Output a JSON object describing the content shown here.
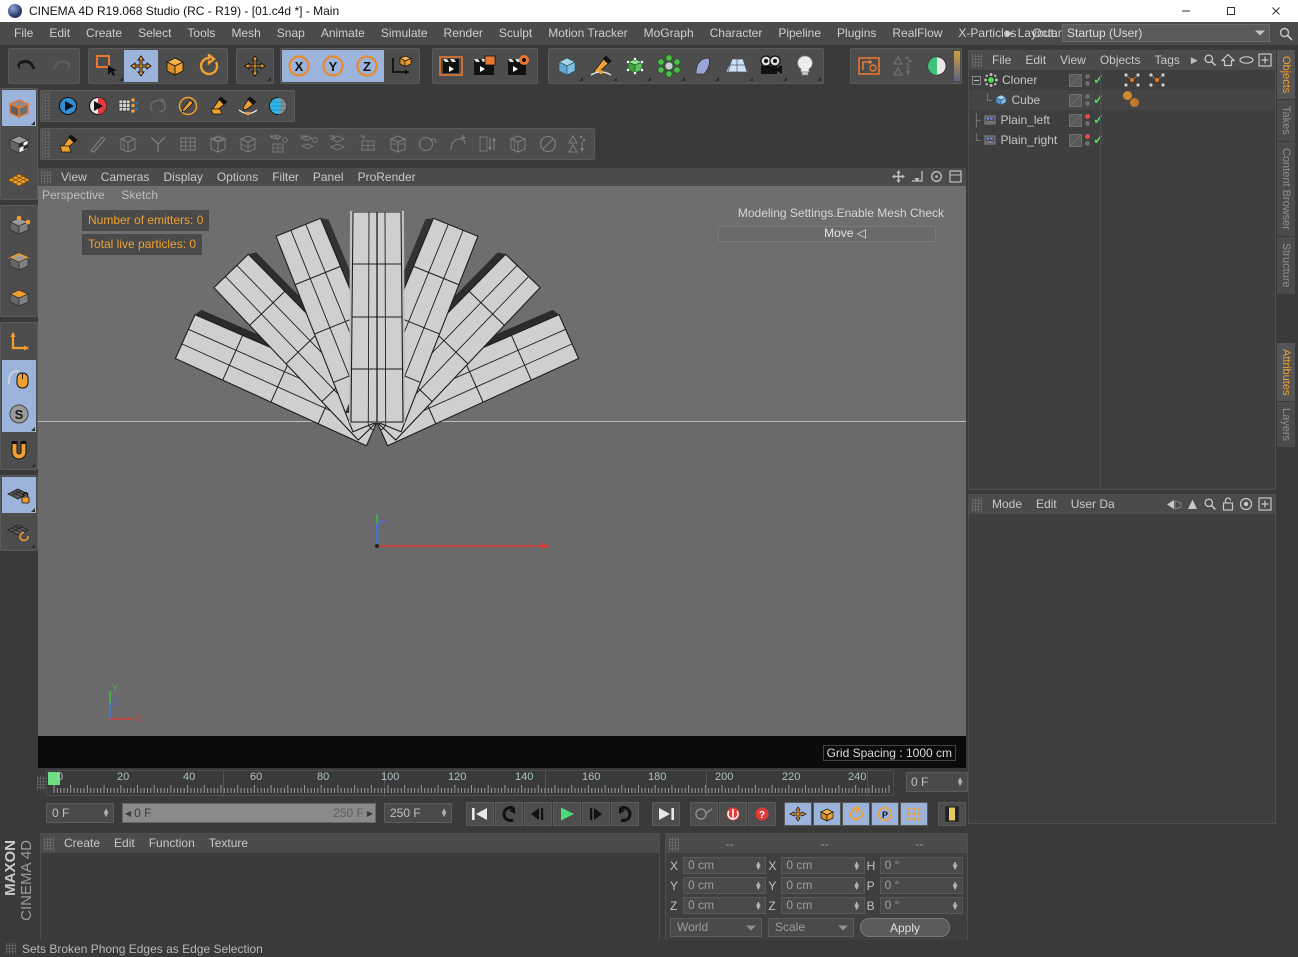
{
  "window": {
    "title": "CINEMA 4D R19.068 Studio (RC - R19) - [01.c4d *] - Main",
    "app_icon": "c4d-logo-icon",
    "minimize": "—",
    "maximize": "☐",
    "close": "✕"
  },
  "menubar": {
    "items": [
      "File",
      "Edit",
      "Create",
      "Select",
      "Tools",
      "Mesh",
      "Snap",
      "Animate",
      "Simulate",
      "Render",
      "Sculpt",
      "Motion Tracker",
      "MoGraph",
      "Character",
      "Pipeline",
      "Plugins",
      "RealFlow",
      "X-Particles",
      "Octane"
    ],
    "layout_label": "Layout:",
    "layout_value": "Startup (User)",
    "search_icon": "magnifier-icon"
  },
  "toolbar": {
    "row1": [
      {
        "name": "undo-button",
        "icon": "undo-arrow-icon",
        "active": false
      },
      {
        "name": "redo-button",
        "icon": "redo-arrow-icon",
        "active": false
      },
      {
        "name": "live-selection-button",
        "icon": "selection-square-icon",
        "active": false
      },
      {
        "name": "move-tool-button",
        "icon": "move-cross-icon",
        "active": true
      },
      {
        "name": "scale-tool-button",
        "icon": "scale-box-icon",
        "active": false
      },
      {
        "name": "rotate-tool-button",
        "icon": "rotate-circle-icon",
        "active": false
      },
      {
        "name": "move-axis-button",
        "icon": "move-cross-icon",
        "active": false
      },
      {
        "name": "lock-x-axis-button",
        "icon": "axis-x-icon",
        "active": true
      },
      {
        "name": "lock-y-axis-button",
        "icon": "axis-y-icon",
        "active": true
      },
      {
        "name": "lock-z-axis-button",
        "icon": "axis-z-icon",
        "active": true
      },
      {
        "name": "world-object-coordinates-button",
        "icon": "world-axis-icon",
        "active": false
      },
      {
        "name": "render-view-button",
        "icon": "render-clapper-icon",
        "active": false
      },
      {
        "name": "render-region-button",
        "icon": "render-region-icon",
        "active": false
      },
      {
        "name": "render-settings-button",
        "icon": "render-gear-icon",
        "active": false
      },
      {
        "name": "add-cube-button",
        "icon": "cube-primitive-icon",
        "active": false
      },
      {
        "name": "add-spline-button",
        "icon": "pen-spline-icon",
        "active": false
      },
      {
        "name": "add-generator-button",
        "icon": "green-cube-icon",
        "active": false
      },
      {
        "name": "add-deformer-button",
        "icon": "deformer-icon",
        "active": false
      },
      {
        "name": "add-scene-button",
        "icon": "bend-object-icon",
        "active": false
      },
      {
        "name": "add-floor-button",
        "icon": "floor-grid-icon",
        "active": false
      },
      {
        "name": "add-camera-button",
        "icon": "camera-icon",
        "active": false
      },
      {
        "name": "add-light-button",
        "icon": "lightbulb-icon",
        "active": false
      },
      {
        "name": "make-editable-button",
        "icon": "make-editable-icon",
        "active": false
      },
      {
        "name": "sort-button",
        "icon": "sort-icon",
        "active": false
      },
      {
        "name": "viewport-shading-button",
        "icon": "half-sphere-icon",
        "active": false
      }
    ],
    "row2": [
      {
        "name": "simulate-play-button",
        "icon": "blue-play-icon",
        "active": false
      },
      {
        "name": "record-button",
        "icon": "red-play-icon",
        "active": false
      },
      {
        "name": "point-mode-grid-button",
        "icon": "points-grid-icon",
        "active": false
      },
      {
        "name": "spline-select-button",
        "icon": "spline-lasso-icon",
        "active": false
      },
      {
        "name": "knife-button",
        "icon": "pen-circle-icon",
        "active": false
      },
      {
        "name": "polygon-pen-button",
        "icon": "polygon-pen-icon",
        "active": false
      },
      {
        "name": "spline-pen-button",
        "icon": "spline-pen-icon",
        "active": false
      },
      {
        "name": "sculpt-brush-button",
        "icon": "blue-sphere-icon",
        "active": false
      }
    ],
    "row3_count": 20
  },
  "left_palette": {
    "groups": [
      [
        {
          "name": "model-mode-button",
          "icon": "model-cube-icon",
          "active": true
        },
        {
          "name": "texture-mode-button",
          "icon": "checker-cube-icon",
          "active": false
        },
        {
          "name": "workplane-mode-button",
          "icon": "orange-grid-icon",
          "active": false
        }
      ],
      [
        {
          "name": "point-mode-button",
          "icon": "point-cube-icon",
          "active": false
        },
        {
          "name": "edge-mode-button",
          "icon": "edge-cube-icon",
          "active": false
        },
        {
          "name": "polygon-mode-button",
          "icon": "polygon-cube-icon",
          "active": false
        }
      ],
      [
        {
          "name": "object-axis-mode-button",
          "icon": "axis-l-icon",
          "active": false
        },
        {
          "name": "viewport-solo-button",
          "icon": "mouse-icon",
          "active": true
        },
        {
          "name": "enable-snapping-button",
          "icon": "s-snap-icon",
          "active": true
        },
        {
          "name": "magnet-button",
          "icon": "magnet-icon",
          "active": false
        }
      ],
      [
        {
          "name": "workplane-lock-button",
          "icon": "grid-lock-icon",
          "active": true
        },
        {
          "name": "planar-workplane-button",
          "icon": "grid-rotate-icon",
          "active": false
        }
      ]
    ]
  },
  "viewport": {
    "menu_items": [
      "View",
      "Cameras",
      "Display",
      "Options",
      "Filter",
      "Panel",
      "ProRender"
    ],
    "perspective_label": "Perspective",
    "sketch_label": "Sketch",
    "hud_emitters": "Number of emitters: 0",
    "hud_particles": "Total live particles: 0",
    "mesh_check_text": "Modeling Settings.Enable Mesh Check",
    "move_text": "Move ◁",
    "grid_spacing": "Grid Spacing : 1000 cm",
    "axis_labels": {
      "x": "X",
      "y": "Y",
      "z": "Z"
    },
    "panel_icons": [
      "move-viewport-icon",
      "scale-viewport-icon",
      "rotate-viewport-icon",
      "maximize-viewport-icon"
    ]
  },
  "object_manager": {
    "menu_items": [
      "File",
      "Edit",
      "View",
      "Objects",
      "Tags"
    ],
    "overflow_icon": "chevron-right-icon",
    "icons": [
      "magnifier-icon",
      "home-icon",
      "eye-icon",
      "expand-icon"
    ],
    "rows": [
      {
        "name": "Cloner",
        "icon": "cloner-icon",
        "indent": 0,
        "expander": "minus",
        "dot_top": "gray",
        "dot_bottom": "gray",
        "check": true,
        "tags": [
          "mograph-tag",
          "mograph-tag"
        ]
      },
      {
        "name": "Cube",
        "icon": "cube-icon",
        "indent": 1,
        "expander": "none",
        "dot_top": "gray",
        "dot_bottom": "gray",
        "check": true,
        "tags": [
          "orange-dot-tag",
          "orange-dot-tag"
        ]
      },
      {
        "name": "Plain_left",
        "icon": "effector-icon",
        "indent": 0,
        "expander": "none",
        "dot_top": "red",
        "dot_bottom": "gray",
        "check": true,
        "tags": []
      },
      {
        "name": "Plain_right",
        "icon": "effector-icon",
        "indent": 0,
        "expander": "none",
        "dot_top": "red",
        "dot_bottom": "gray",
        "check": true,
        "tags": []
      }
    ]
  },
  "attribute_manager": {
    "menu_items": [
      "Mode",
      "Edit",
      "User Da"
    ],
    "icons": [
      "back-nav-icon",
      "forward-nav-icon",
      "up-arrow-icon",
      "magnifier-icon",
      "lock-icon",
      "target-icon",
      "expand-icon"
    ]
  },
  "right_tabs": {
    "top": [
      {
        "label": "Objects",
        "active": true
      },
      {
        "label": "Takes",
        "active": false
      },
      {
        "label": "Content Browser",
        "active": false
      },
      {
        "label": "Structure",
        "active": false
      }
    ],
    "bottom": [
      {
        "label": "Attributes",
        "active": true
      },
      {
        "label": "Layers",
        "active": false
      }
    ]
  },
  "timeline": {
    "labels": [
      "0",
      "20",
      "40",
      "60",
      "80",
      "100",
      "120",
      "140",
      "160",
      "180",
      "200",
      "220",
      "240"
    ],
    "current_frame_field": "0 F",
    "start_field": "0 F",
    "slider_left": "0 F",
    "slider_right": "250 F",
    "end_field": "250 F",
    "range_end": "250 F"
  },
  "transport": {
    "buttons": [
      {
        "name": "goto-start-button",
        "icon": "skip-start-icon"
      },
      {
        "name": "previous-keyframe-button",
        "icon": "prev-key-icon"
      },
      {
        "name": "previous-frame-button",
        "icon": "step-back-icon"
      },
      {
        "name": "play-button",
        "icon": "play-icon"
      },
      {
        "name": "next-frame-button",
        "icon": "step-forward-icon"
      },
      {
        "name": "next-keyframe-button",
        "icon": "next-key-icon"
      },
      {
        "name": "goto-end-button",
        "icon": "skip-end-icon"
      }
    ],
    "record_buttons": [
      {
        "name": "record-active-objects-button",
        "icon": "key-icon",
        "active": false
      },
      {
        "name": "autokeying-button",
        "icon": "red-record-icon",
        "active": false
      },
      {
        "name": "keyframe-selection-button",
        "icon": "question-record-icon",
        "active": false
      }
    ],
    "toggle_buttons": [
      {
        "name": "position-key-button",
        "icon": "move-cross-icon",
        "active": true
      },
      {
        "name": "scale-key-button",
        "icon": "scale-box-icon",
        "active": true
      },
      {
        "name": "rotation-key-button",
        "icon": "rotate-circle-icon",
        "active": true
      },
      {
        "name": "parameter-key-button",
        "icon": "p-circle-icon",
        "active": true
      },
      {
        "name": "point-level-animation-button",
        "icon": "pla-dots-icon",
        "active": true
      }
    ],
    "timeline_button": {
      "name": "open-timeline-button",
      "icon": "film-strip-icon"
    }
  },
  "material_manager": {
    "menu_items": [
      "Create",
      "Edit",
      "Function",
      "Texture"
    ]
  },
  "coordinates": {
    "headers": [
      "--",
      "--",
      "--"
    ],
    "position": {
      "label_x": "X",
      "label_y": "Y",
      "label_z": "Z",
      "x": "0 cm",
      "y": "0 cm",
      "z": "0 cm"
    },
    "size": {
      "label_x": "X",
      "label_y": "Y",
      "label_z": "Z",
      "x": "0 cm",
      "y": "0 cm",
      "z": "0 cm"
    },
    "rotation": {
      "label_h": "H",
      "label_p": "P",
      "label_b": "B",
      "h": "0 °",
      "p": "0 °",
      "b": "0 °"
    },
    "coord_system": "World",
    "size_mode": "Scale",
    "apply_label": "Apply"
  },
  "branding": {
    "maxon": "MAXON",
    "cinema4d": "CINEMA 4D"
  },
  "statusbar": {
    "message": "Sets Broken Phong Edges as Edge Selection"
  },
  "colors": {
    "accent_orange": "#f0a030",
    "active_blue": "#9cb4dc",
    "panel_bg": "#3f3f3f",
    "menu_bg": "#4b4b4b",
    "viewport_bg": "#6a6a6a",
    "green_check": "#4ddc5a",
    "red_dot": "#e14b4b"
  }
}
